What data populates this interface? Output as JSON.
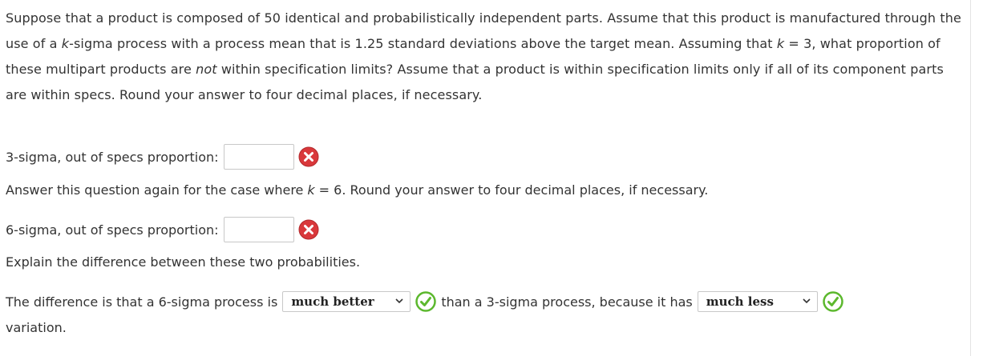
{
  "question": {
    "part1": "Suppose that a product is composed of 50 identical and probabilistically independent parts. Assume that this product is manufactured through the use of a ",
    "k_var": "k",
    "part2": "-sigma process with a process mean that is 1.25 standard deviations above the target mean. Assuming that ",
    "k_var2": "k",
    "part3": " = 3, what proportion of these multipart products are ",
    "not_word": "not",
    "part4": " within specification limits? Assume that a product is within specification limits only if all of its component parts are within specs. Round your answer to four decimal places, if necessary."
  },
  "answers": {
    "three_sigma_label": "3-sigma, out of specs proportion:",
    "three_sigma_value": "",
    "three_sigma_status": "incorrect",
    "again_prefix": "Answer this question again for the case where ",
    "again_k": "k",
    "again_suffix": " = 6. Round your answer to four decimal places, if necessary.",
    "six_sigma_label": "6-sigma, out of specs proportion:",
    "six_sigma_value": "",
    "six_sigma_status": "incorrect",
    "explain_prompt": "Explain the difference between these two probabilities.",
    "sentence_part1": "The difference is that a 6-sigma process is",
    "select1_value": "much better",
    "select1_status": "correct",
    "sentence_part2": "than a 3-sigma process, because it has",
    "select2_value": "much less",
    "select2_status": "correct",
    "sentence_part3": "variation."
  },
  "colors": {
    "incorrect": "#d9383b",
    "correct": "#5cb82e",
    "text": "#333333"
  }
}
